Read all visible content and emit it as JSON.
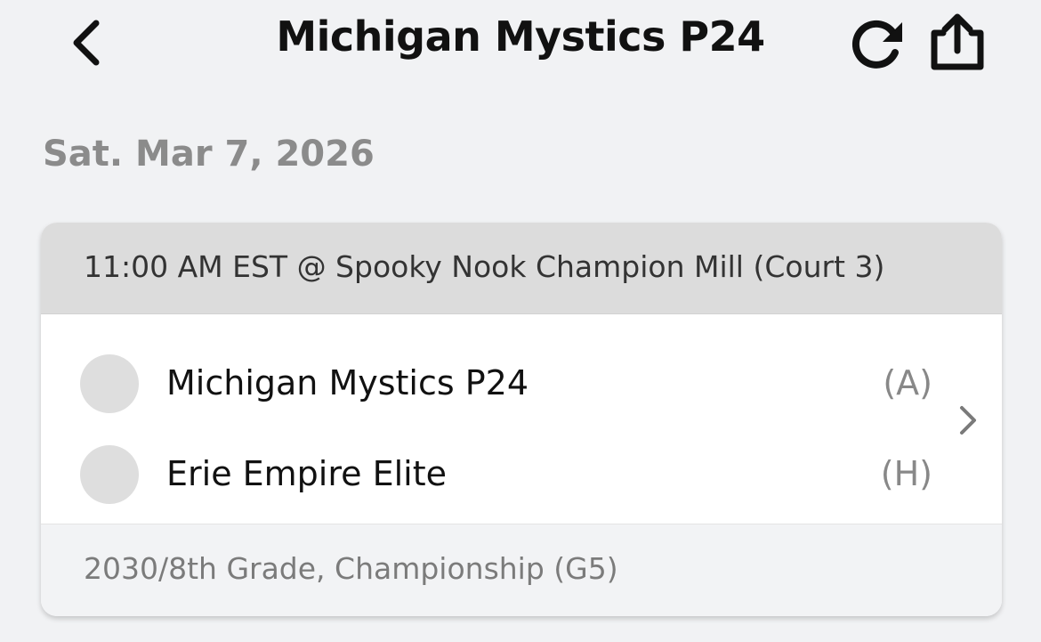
{
  "header": {
    "title": "Michigan Mystics P24",
    "back_icon": "chevron-left-icon",
    "refresh_icon": "refresh-icon",
    "share_icon": "share-icon"
  },
  "date": "Sat. Mar 7, 2026",
  "game": {
    "time_location": "11:00 AM EST @ Spooky Nook Champion Mill (Court 3)",
    "teams": [
      {
        "name": "Michigan Mystics P24",
        "side": "(A)"
      },
      {
        "name": "Erie Empire Elite",
        "side": "(H)"
      }
    ],
    "division": "2030/8th Grade, Championship (G5)",
    "chevron_icon": "chevron-right-icon"
  },
  "colors": {
    "background": "#f1f2f4",
    "card_header": "#dcdcdc",
    "card_footer": "#f2f3f5",
    "date_text": "#8b8b8b",
    "avatar": "#dedede"
  }
}
